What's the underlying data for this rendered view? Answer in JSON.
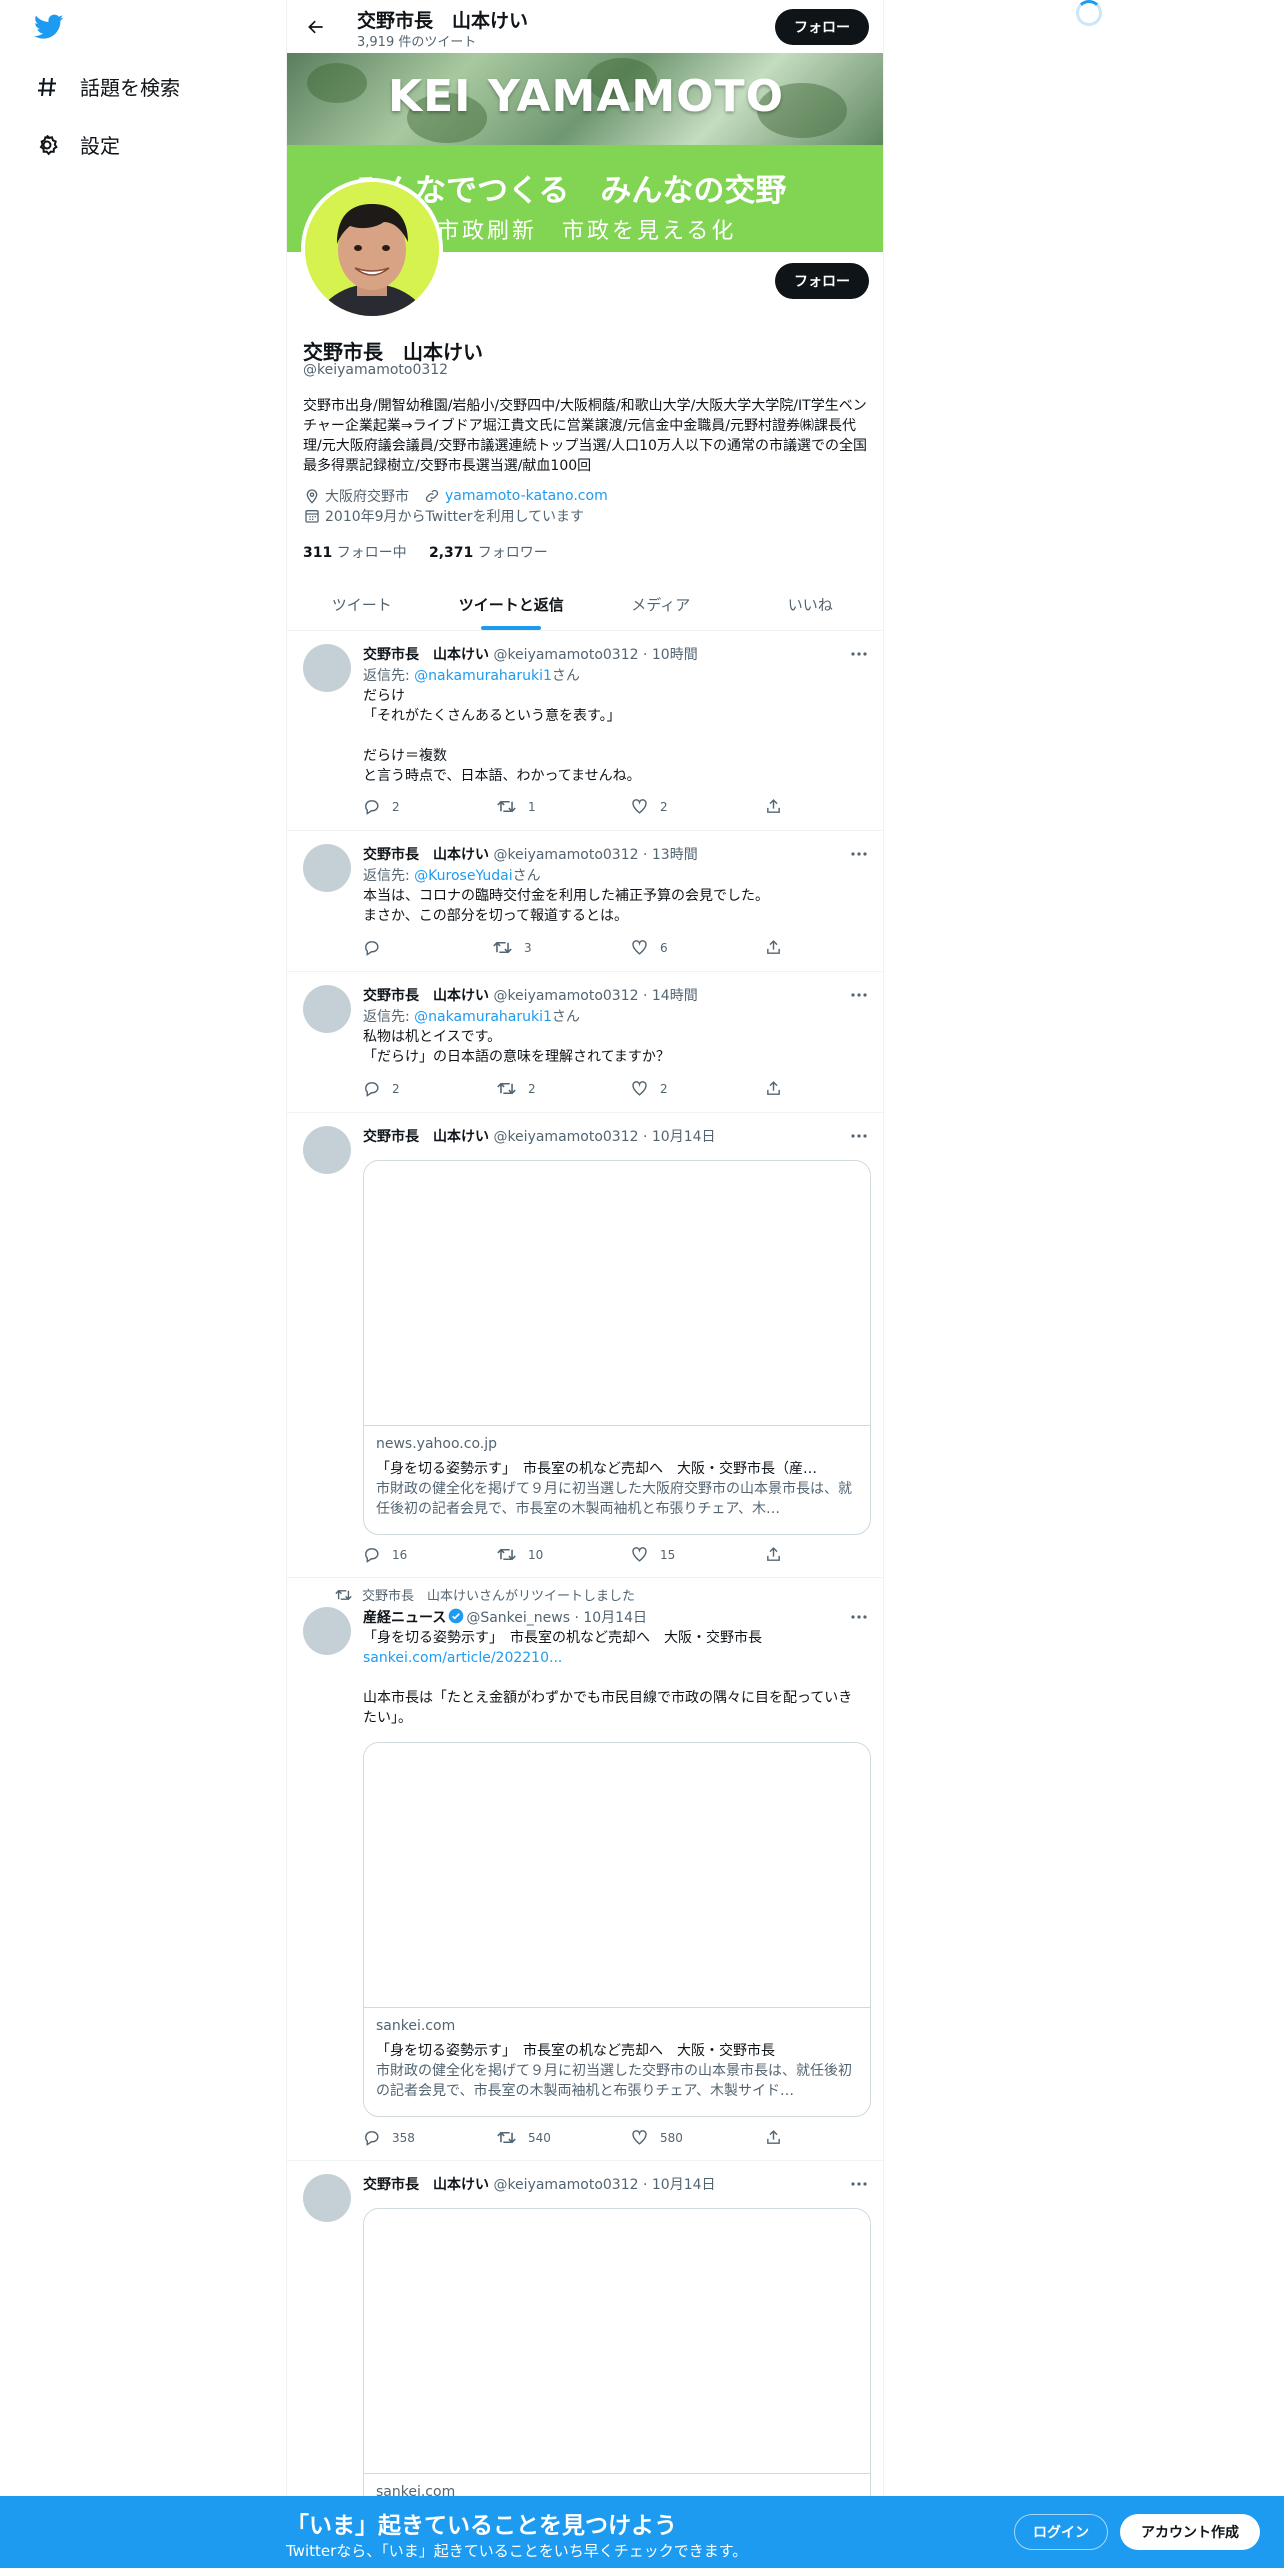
{
  "nav": {
    "explore_label": "話題を検索",
    "settings_label": "設定"
  },
  "header": {
    "title": "交野市長　山本けい",
    "tweet_count": "3,919 件のツイート",
    "follow_label": "フォロー"
  },
  "banner": {
    "name_text": "KEI YAMAMOTO",
    "line1": "みんなでつくる　みんなの交野",
    "line2": "市政刷新　市政を見える化"
  },
  "profile": {
    "follow_label": "フォロー",
    "name": "交野市長　山本けい",
    "handle": "@keiyamamoto0312",
    "bio": "交野市出身/開智幼稚園/岩船小/交野四中/大阪桐蔭/和歌山大学/大阪大学大学院/IT学生ベンチャー企業起業⇒ライブドア堀江貴文氏に営業譲渡/元信金中金職員/元野村證券㈱課長代理/元大阪府議会議員/交野市議選連続トップ当選/人口10万人以下の通常の市議選での全国最多得票記録樹立/交野市長選当選/献血100回",
    "location": "大阪府交野市",
    "url": "yamamoto-katano.com",
    "joined": "2010年9月からTwitterを利用しています",
    "following_count": "311",
    "following_label": "フォロー中",
    "followers_count": "2,371",
    "followers_label": "フォロワー"
  },
  "tabs": [
    "ツイート",
    "ツイートと返信",
    "メディア",
    "いいね"
  ],
  "active_tab": "ツイートと返信",
  "tweets": [
    {
      "name": "交野市長　山本けい",
      "handle": "@keiyamamoto0312",
      "time": "· 10時間",
      "reply_prefix": "返信先: ",
      "reply_user": "@nakamuraharuki1",
      "reply_suffix": "さん",
      "text": "だらけ\n「それがたくさんあるという意を表す。」\n\nだらけ＝複数\nと言う時点で、日本語、わかってませんね。",
      "replies": "2",
      "retweets": "1",
      "likes": "2"
    },
    {
      "name": "交野市長　山本けい",
      "handle": "@keiyamamoto0312",
      "time": "· 13時間",
      "reply_prefix": "返信先: ",
      "reply_user": "@KuroseYudai",
      "reply_suffix": "さん",
      "text": "本当は、コロナの臨時交付金を利用した補正予算の会見でした。\nまさか、この部分を切って報道するとは。",
      "replies": "",
      "retweets": "3",
      "likes": "6"
    },
    {
      "name": "交野市長　山本けい",
      "handle": "@keiyamamoto0312",
      "time": "· 14時間",
      "reply_prefix": "返信先: ",
      "reply_user": "@nakamuraharuki1",
      "reply_suffix": "さん",
      "text": "私物は机とイスです。\n「だらけ」の日本語の意味を理解されてますか？",
      "replies": "2",
      "retweets": "2",
      "likes": "2"
    },
    {
      "name": "交野市長　山本けい",
      "handle": "@keiyamamoto0312",
      "time": "· 10月14日",
      "card_domain": "news.yahoo.co.jp",
      "card_title": "「身を切る姿勢示す」　市長室の机など売却へ　大阪・交野市長（産…",
      "card_desc": "市財政の健全化を掲げて９月に初当選した大阪府交野市の山本景市長は、就任後初の記者会見で、市長室の木製両袖机と布張りチェア、木…",
      "replies": "16",
      "retweets": "10",
      "likes": "15"
    },
    {
      "retweet_note": "交野市長　山本けいさんがリツイートしました",
      "name": "産経ニュース",
      "handle": "@Sankei_news",
      "time": "· 10月14日",
      "text": "「身を切る姿勢示す」　市長室の机など売却へ　大阪・交野市長",
      "link": "sankei.com/article/202210...",
      "text2": "山本市長は「たとえ金額がわずかでも市民目線で市政の隅々に目を配っていきたい」。",
      "card_domain": "sankei.com",
      "card_title": "「身を切る姿勢示す」　市長室の机など売却へ　大阪・交野市長",
      "card_desc": "市財政の健全化を掲げて９月に初当選した交野市の山本景市長は、就任後初の記者会見で、市長室の木製両袖机と布張りチェア、木製サイド…",
      "replies": "358",
      "retweets": "540",
      "likes": "580"
    },
    {
      "name": "交野市長　山本けい",
      "handle": "@keiyamamoto0312",
      "time": "· 10月14日",
      "card_domain": "sankei.com"
    }
  ],
  "bottom_bar": {
    "title": "「いま」起きていることを見つけよう",
    "subtitle": "Twitterなら、「いま」起きていることをいち早くチェックできます。",
    "login_label": "ログイン",
    "signup_label": "アカウント作成"
  },
  "colors": {
    "accent": "#1d9bf0",
    "banner_green": "#82d552",
    "text_primary": "#0f1419",
    "text_secondary": "#536471"
  }
}
